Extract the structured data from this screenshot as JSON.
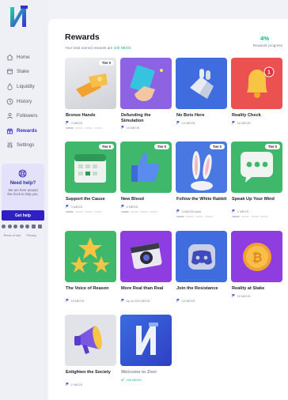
{
  "colors": {
    "accent": "#2e20c4",
    "success": "#16b27d",
    "card_bronze": "#d9dade",
    "card_purple": "#8e63e3",
    "card_blue": "#3f6cde",
    "card_red": "#e94a4a",
    "card_green": "#3fb86b"
  },
  "sidebar": {
    "nav": [
      {
        "label": "Home",
        "icon": "home-icon",
        "active": false
      },
      {
        "label": "Stake",
        "icon": "stake-icon",
        "active": false
      },
      {
        "label": "Liquidity",
        "icon": "liquidity-icon",
        "active": false
      },
      {
        "label": "History",
        "icon": "history-icon",
        "active": false
      },
      {
        "label": "Followers",
        "icon": "followers-icon",
        "active": false
      },
      {
        "label": "Rewards",
        "icon": "gift-icon",
        "active": true
      },
      {
        "label": "Settings",
        "icon": "sliders-icon",
        "active": false
      }
    ],
    "help": {
      "title": "Need help?",
      "text": "We are here around the clock to help you.",
      "button": "Get help"
    },
    "social_icons": [
      "facebook-icon",
      "twitter-icon",
      "telegram-icon",
      "discord-icon",
      "reddit-icon",
      "medium-icon",
      "email-icon"
    ],
    "legal": {
      "terms": "Terms of Use",
      "privacy": "Privacy"
    }
  },
  "header": {
    "title": "Rewards",
    "subtitle_prefix": "Your total earned rewards are",
    "subtitle_value": "100 NEOS",
    "progress_value": "4%",
    "progress_label": "Rewards progress"
  },
  "cards": [
    {
      "title": "Bronze Hands",
      "meta": "3 NEOS",
      "tier": "Tier 0",
      "art": "ticket-icon",
      "progress_total": 4,
      "progress_done": 1
    },
    {
      "title": "Defunding the Simulation",
      "meta": "10 NEOS",
      "tier": "",
      "art": "sticky-note-icon"
    },
    {
      "title": "No Bots Here",
      "meta": "10 NEOS",
      "tier": "",
      "art": "robot-hand-icon"
    },
    {
      "title": "Reality Check",
      "meta": "10 NEOS",
      "tier": "",
      "art": "notification-bell-icon",
      "badge": "1"
    },
    {
      "title": "Support the Cause",
      "meta": "3 NEOS",
      "tier": "Tier 0",
      "art": "calendar-icon",
      "progress_total": 4,
      "progress_done": 1
    },
    {
      "title": "New Blood",
      "meta": "3 NEOS",
      "tier": "Tier 0",
      "art": "thumbs-up-icon",
      "progress_total": 4,
      "progress_done": 1
    },
    {
      "title": "Follow the White Rabbit",
      "meta": "3 NEOS each",
      "tier": "Tier 0",
      "art": "rabbit-ears-icon",
      "progress_total": 4,
      "progress_done": 1
    },
    {
      "title": "Speak Up Your Mind",
      "meta": "1 NEOS",
      "tier": "Tier 0",
      "art": "chat-bubble-icon",
      "progress_total": 4,
      "progress_done": 1
    },
    {
      "title": "The Voice of Reason",
      "meta": "15 NEOS",
      "tier": "",
      "art": "stars-icon"
    },
    {
      "title": "More Real than Real",
      "meta": "Up to 200 NEOS",
      "tier": "",
      "art": "camera-icon"
    },
    {
      "title": "Join the Resistance",
      "meta": "10 NEOS",
      "tier": "",
      "art": "discord-icon"
    },
    {
      "title": "Reality at Stake",
      "meta": "10 NEOS",
      "tier": "",
      "art": "bitcoin-coin-icon"
    },
    {
      "title": "Enlighten the Society",
      "meta": "2 NEOS",
      "tier": "",
      "art": "megaphone-icon"
    },
    {
      "title": "Welcome to Zion",
      "meta": "100 NEOS",
      "tier": "",
      "art": "zion-logo-icon",
      "completed": true
    }
  ]
}
